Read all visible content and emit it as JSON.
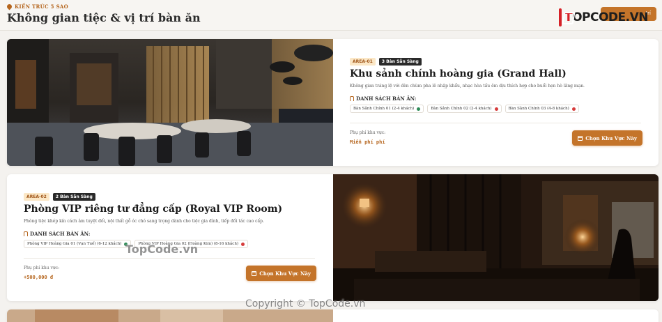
{
  "header": {
    "eyebrow": "KIẾN TRÚC 5 SAO",
    "title": "Không gian tiệc & vị trí bàn ăn",
    "logo_top": "T",
    "logo_rest": "OPCODE.VN",
    "right_button_label": "trí"
  },
  "areas": [
    {
      "code": "AREA-01",
      "ready": "3 Bàn Sẵn Sàng",
      "title": "Khu sảnh chính hoàng gia (Grand Hall)",
      "description": "Không gian tráng lệ với đèn chùm pha lê nhập khẩu, nhạc hòa tấu êm dịu thích hợp cho buổi hẹn hò lãng mạn.",
      "tables_label": "DANH SÁCH BÀN ĂN:",
      "tables": [
        {
          "name": "Bàn Sảnh Chính 01 (2-4 khách)",
          "status_color": "#2e8b57"
        },
        {
          "name": "Bàn Sảnh Chính 02 (2-4 khách)",
          "status_color": "#d63b3b"
        },
        {
          "name": "Bàn Sảnh Chính 03 (4-8 khách)",
          "status_color": "#d63b3b"
        }
      ],
      "fee_label": "Phụ phí khu vực:",
      "fee_value": "Miễn phí phí",
      "button_label": "Chọn Khu Vực Này"
    },
    {
      "code": "AREA-02",
      "ready": "2 Bàn Sẵn Sàng",
      "title": "Phòng VIP riêng tư đẳng cấp (Royal VIP Room)",
      "description": "Phòng tiệc khép kín cách âm tuyệt đối, nội thất gỗ óc chó sang trọng dành cho tiệc gia đình, tiếp đối tác cao cấp.",
      "tables_label": "DANH SÁCH BÀN ĂN:",
      "tables": [
        {
          "name": "Phòng VIP Hoàng Gia 01 (Vạn Tuế) (6-12 khách)",
          "status_color": "#2e8b57"
        },
        {
          "name": "Phòng VIP Hoàng Gia 02 (Hoàng Kim) (8-16 khách)",
          "status_color": "#d63b3b"
        }
      ],
      "fee_label": "Phụ phí khu vực:",
      "fee_value": "+500,000 đ",
      "button_label": "Chọn Khu Vực Này"
    }
  ],
  "watermarks": {
    "center": "TopCode.vn",
    "bottom": "Copyright © TopCode.vn"
  },
  "colors": {
    "accent": "#c4742a",
    "available": "#2e8b57",
    "booked": "#d63b3b"
  }
}
